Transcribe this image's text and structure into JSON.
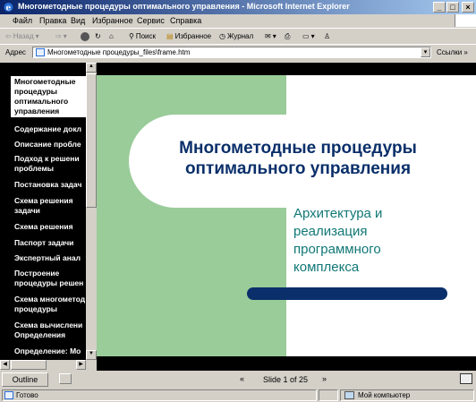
{
  "window": {
    "title": "Многометодные процедуры оптимального управления - Microsoft Internet Explorer"
  },
  "menu": [
    "Файл",
    "Правка",
    "Вид",
    "Избранное",
    "Сервис",
    "Справка"
  ],
  "toolbar": {
    "back": "Назад",
    "search": "Поиск",
    "favorites": "Избранное",
    "history": "Журнал"
  },
  "address": {
    "label": "Адрес",
    "value": "Многометодные процедуры_files\\frame.htm",
    "links": "Ссылки"
  },
  "outline": {
    "items": [
      "Многометодные процедуры оптимального управления",
      "Содержание докл",
      "Описание пробле",
      "Подход к решени проблемы",
      "Постановка задач",
      "Схема решения задачи",
      "Схема решения",
      "Паспорт задачи",
      "Экспертный анал",
      "Построение процедуры решен",
      "Схема многометод процедуры",
      "Схема вычислени Определения",
      "Определение: Мо"
    ]
  },
  "slide": {
    "title": "Многометодные процедуры оптимального управления",
    "subtitle": "Архитектура и реализация программного комплекса",
    "colors": {
      "green": "#99cc99",
      "navy": "#0a2f6a",
      "teal": "#117777"
    }
  },
  "bottombar": {
    "outline_label": "Outline",
    "slide_counter": "Slide 1 of 25"
  },
  "status": {
    "left": "Готово",
    "zone": "Мой компьютер"
  }
}
